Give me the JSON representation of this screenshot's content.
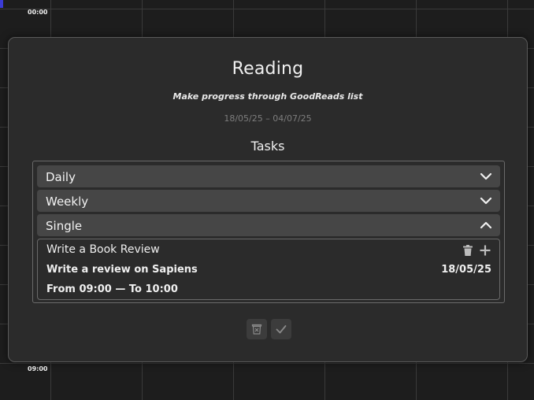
{
  "calendar": {
    "time_labels": [
      "00:00",
      "09:00"
    ]
  },
  "goal": {
    "title": "Reading",
    "description": "Make progress through GoodReads list",
    "date_range": "18/05/25 – 04/07/25"
  },
  "tasks": {
    "heading": "Tasks",
    "sections": [
      {
        "label": "Daily",
        "expanded": false,
        "icon": "chevron-down-icon"
      },
      {
        "label": "Weekly",
        "expanded": false,
        "icon": "chevron-down-icon"
      },
      {
        "label": "Single",
        "expanded": true,
        "icon": "chevron-up-icon"
      }
    ],
    "single_items": [
      {
        "title": "Write a Book Review",
        "description": "Write a review on Sapiens",
        "date": "18/05/25",
        "time": "From 09:00 — To 10:00",
        "icons": [
          "trash-icon",
          "plus-icon"
        ]
      }
    ]
  },
  "actions": {
    "icons": [
      "delete-bin-icon",
      "checkmark-icon"
    ]
  },
  "colors": {
    "background": "#1d1d1d",
    "modal": "#2b2b2b",
    "section_header": "#464646",
    "accent": "#3b3bd6",
    "muted_text": "#7d7d7d"
  }
}
